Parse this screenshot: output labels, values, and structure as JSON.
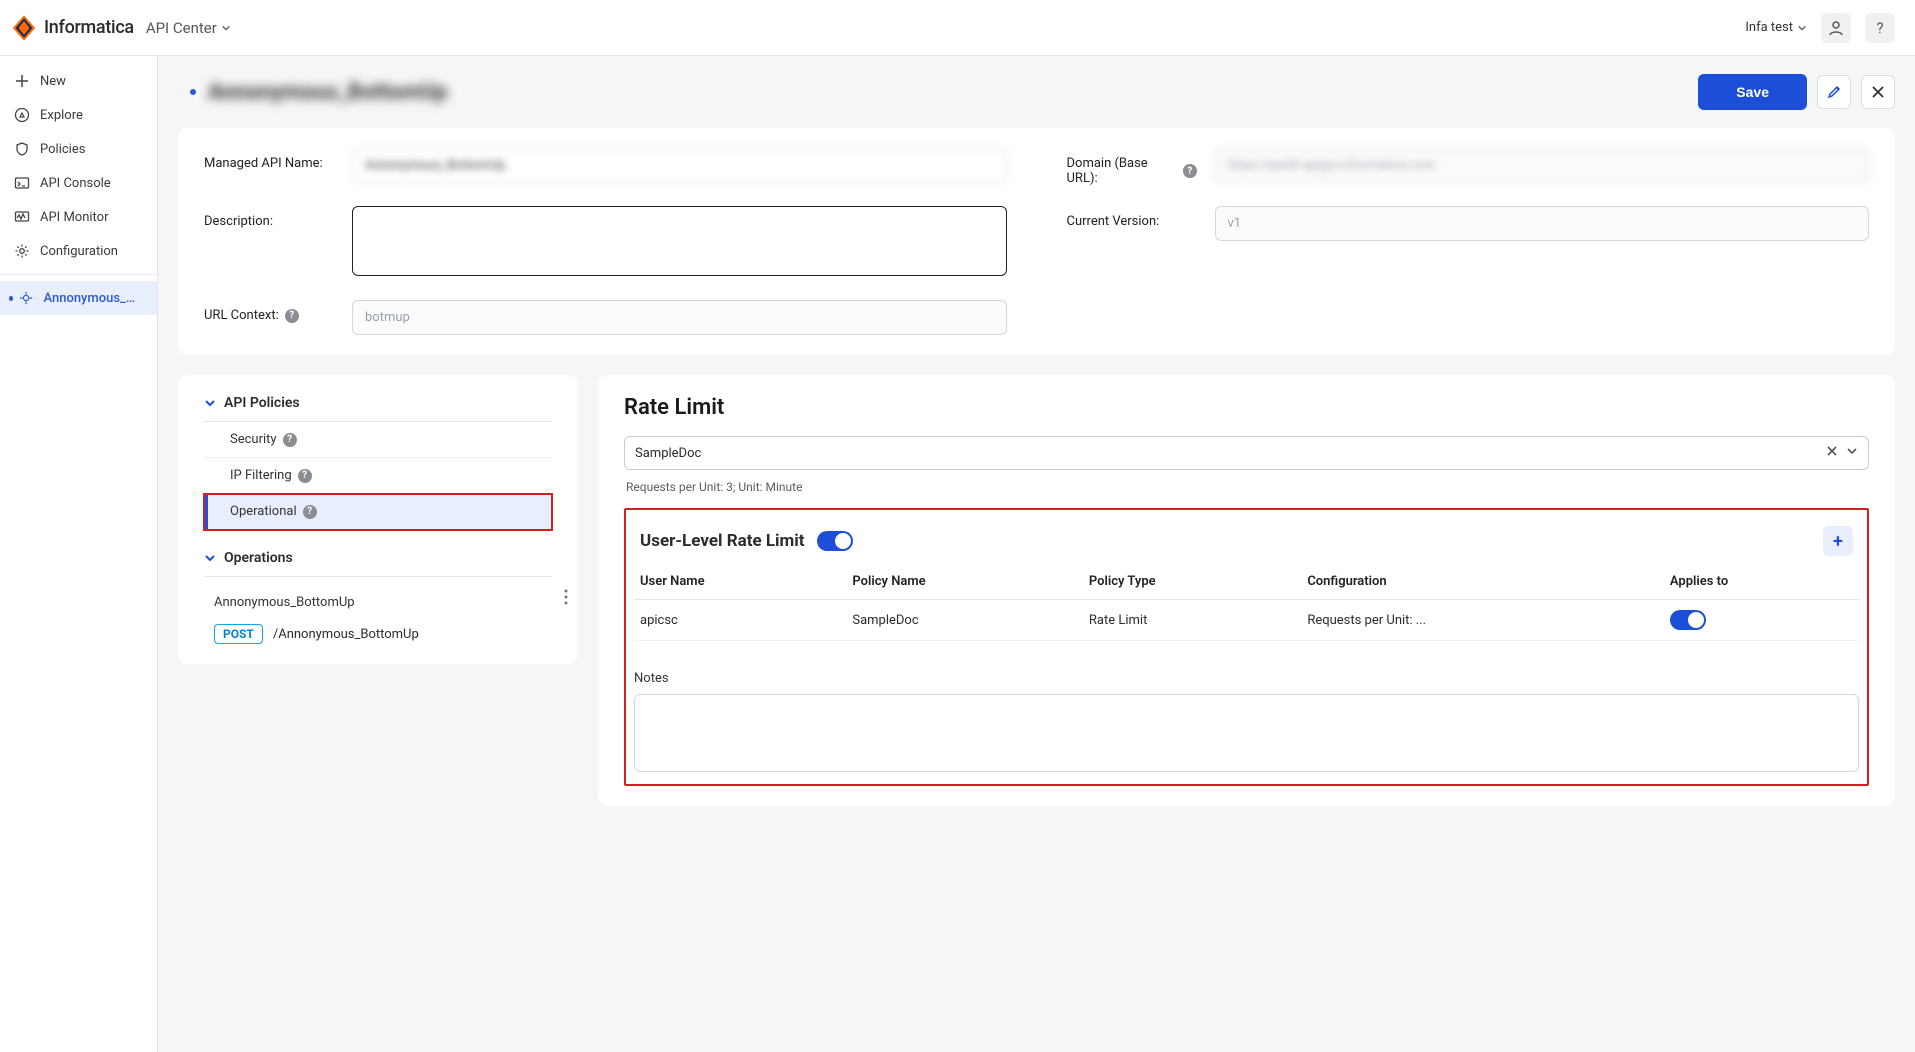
{
  "header": {
    "brand": "Informatica",
    "app": "API Center",
    "user": "Infa test"
  },
  "sidebar": {
    "items": [
      {
        "icon": "plus",
        "label": "New"
      },
      {
        "icon": "compass",
        "label": "Explore"
      },
      {
        "icon": "shield",
        "label": "Policies"
      },
      {
        "icon": "console",
        "label": "API Console"
      },
      {
        "icon": "monitor",
        "label": "API Monitor"
      },
      {
        "icon": "gear",
        "label": "Configuration"
      }
    ],
    "active": {
      "icon": "api",
      "label": "Annonymous_Bot..."
    }
  },
  "page_title_obscured": "Annonymous_BottomUp",
  "toolbar": {
    "save_label": "Save"
  },
  "form": {
    "managed_api_name_label": "Managed API Name:",
    "managed_api_name_value": "Annonymous_BottomUp",
    "description_label": "Description:",
    "url_context_label": "URL Context:",
    "url_context_value": "botmup",
    "domain_label": "Domain (Base URL):",
    "domain_value": "https://podX-apigw.informatica.com",
    "version_label": "Current Version:",
    "version_value": "v1"
  },
  "policies_panel": {
    "heading": "API Policies",
    "items": [
      "Security",
      "IP Filtering",
      "Operational"
    ],
    "selected_index": 2,
    "operations_heading": "Operations",
    "operation_name": "Annonymous_BottomUp",
    "operation_method": "POST",
    "operation_path": "/Annonymous_BottomUp"
  },
  "rate_limit_panel": {
    "title": "Rate Limit",
    "combo_value": "SampleDoc",
    "hint": "Requests per Unit: 3; Unit: Minute",
    "user_level_title": "User-Level Rate Limit",
    "user_level_enabled": true,
    "columns": [
      "User Name",
      "Policy Name",
      "Policy Type",
      "Configuration",
      "Applies to"
    ],
    "row": {
      "user_name": "apicsc",
      "policy_name": "SampleDoc",
      "policy_type": "Rate Limit",
      "configuration": "Requests per Unit: ...",
      "applies_to": true
    },
    "notes_label": "Notes"
  }
}
